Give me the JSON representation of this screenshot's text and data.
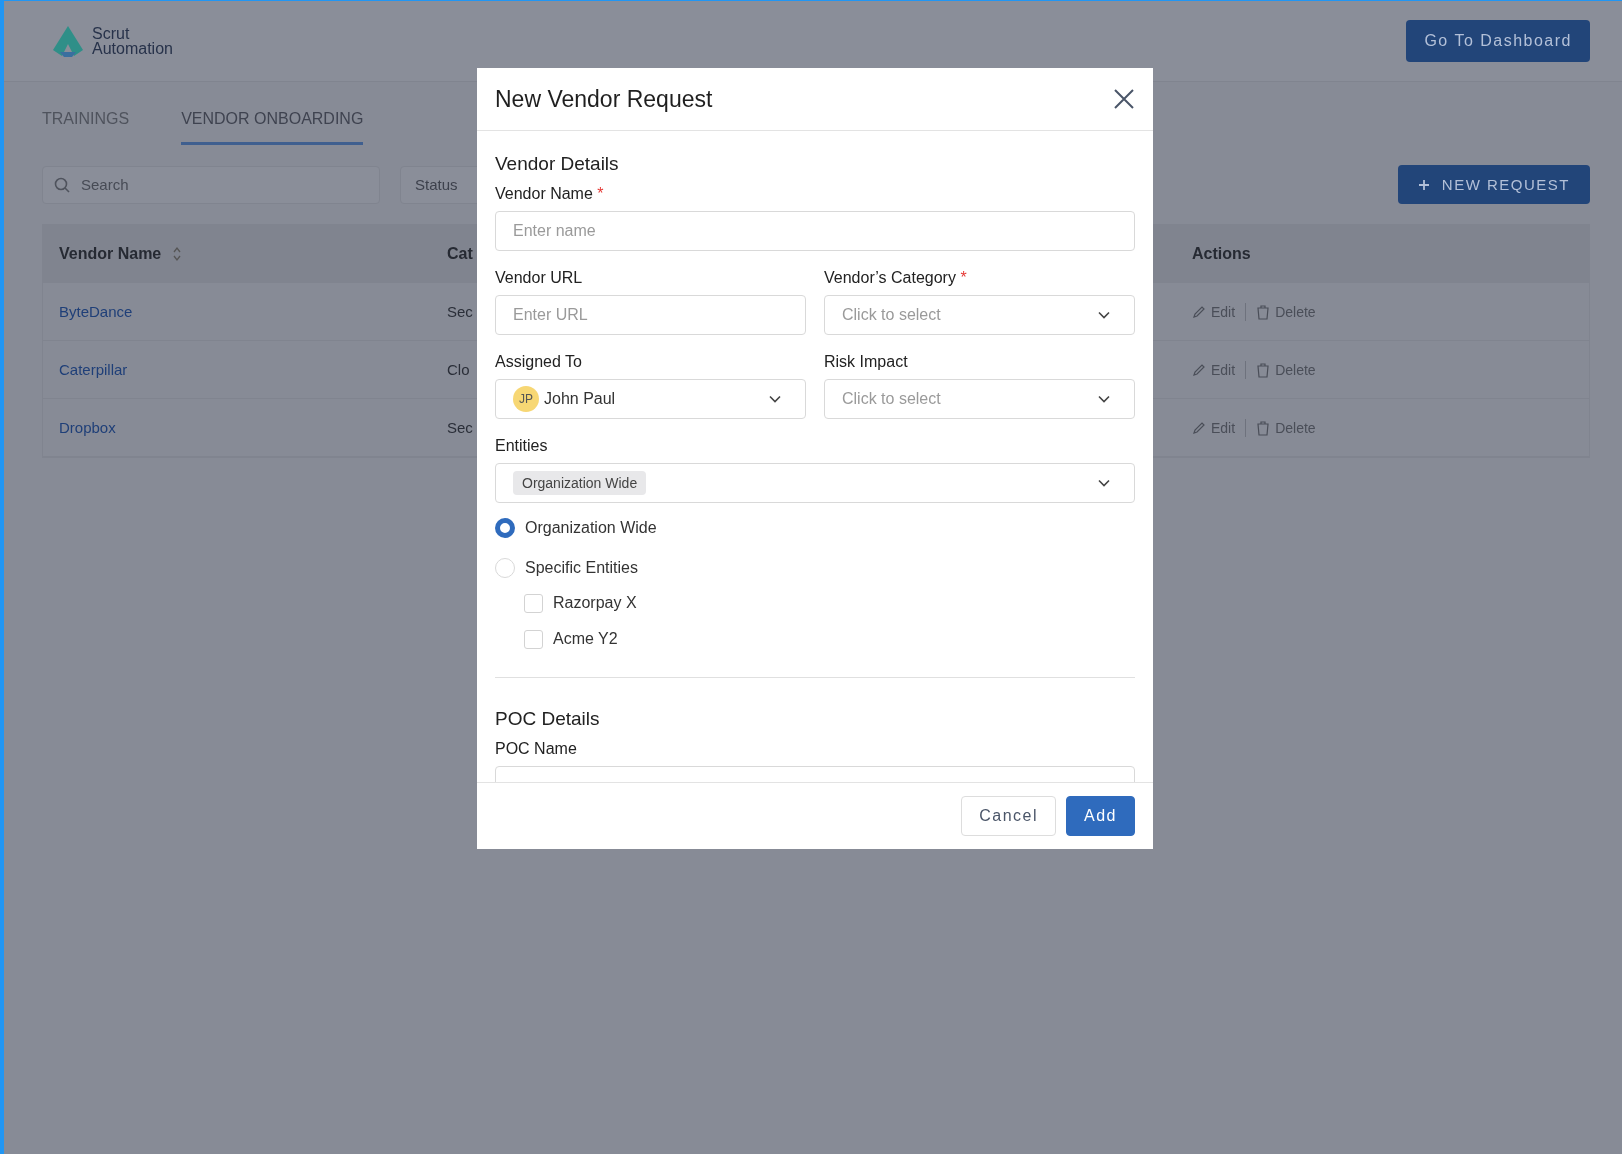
{
  "header": {
    "logo_lines": [
      "Scrut",
      "Automation"
    ],
    "dashboard_button": "Go To Dashboard"
  },
  "tabs": [
    {
      "label": "TRAININGS",
      "selected": false
    },
    {
      "label": "VENDOR ONBOARDING",
      "selected": true
    }
  ],
  "toolbar": {
    "search": {
      "placeholder": "Search"
    },
    "status_filter": "Status",
    "new_request": "NEW REQUEST"
  },
  "table": {
    "columns": [
      "Vendor Name",
      "Cat",
      "Actions"
    ],
    "rows": [
      {
        "vendor": "ByteDance",
        "category": "Sec",
        "edit": "Edit",
        "delete": "Delete"
      },
      {
        "vendor": "Caterpillar",
        "category": "Clo",
        "edit": "Edit",
        "delete": "Delete"
      },
      {
        "vendor": "Dropbox",
        "category": "Sec",
        "edit": "Edit",
        "delete": "Delete"
      }
    ]
  },
  "modal": {
    "title": "New Vendor Request",
    "vendor_details": {
      "heading": "Vendor Details",
      "rows": [
        [
          {
            "kind": "text",
            "label": "Vendor Name",
            "required_mark": "*",
            "placeholder": "Enter name"
          }
        ],
        [
          {
            "kind": "text",
            "label": "Vendor URL",
            "placeholder": "Enter URL"
          },
          {
            "kind": "select",
            "label": "Vendor’s Category",
            "required_mark": "*",
            "placeholder": "Click to select"
          }
        ],
        [
          {
            "kind": "person",
            "label": "Assigned To",
            "initials": "JP",
            "value": "John Paul"
          },
          {
            "kind": "select",
            "label": "Risk Impact",
            "placeholder": "Click to select"
          }
        ]
      ]
    },
    "entities": {
      "label": "Entities",
      "tags": [
        "Organization Wide"
      ],
      "options": [
        {
          "label": "Organization Wide",
          "selected": true
        },
        {
          "label": "Specific Entities",
          "selected": false,
          "children": [
            {
              "label": "Razorpay X",
              "checked": false
            },
            {
              "label": "Acme Y2",
              "checked": false
            }
          ]
        }
      ]
    },
    "poc_details": {
      "heading": "POC Details",
      "field_label": "POC Name"
    },
    "buttons": [
      {
        "label": "Cancel",
        "kind": "secondary"
      },
      {
        "label": "Add",
        "kind": "primary"
      }
    ]
  }
}
